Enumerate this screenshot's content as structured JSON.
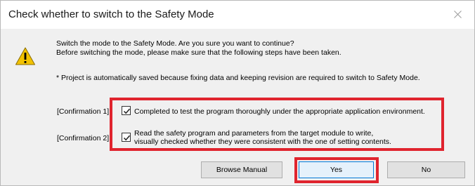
{
  "window": {
    "title": "Check whether to switch to the Safety Mode"
  },
  "message": {
    "line1": "Switch the mode to the Safety Mode. Are you sure you want to continue?",
    "line2": "Before switching the mode, please make sure that the following steps have been taken.",
    "note": "* Project is automatically saved because fixing data and keeping revision are required to switch to Safety Mode."
  },
  "confirmations": [
    {
      "label": "[Confirmation 1]",
      "checked": true,
      "text_lines": [
        "Completed to test the program thoroughly under the appropriate application environment."
      ]
    },
    {
      "label": "[Confirmation 2]",
      "checked": true,
      "text_lines": [
        "Read the safety program and parameters from the target module to write,",
        "visually checked whether they were consistent with the one of setting contents."
      ]
    }
  ],
  "buttons": {
    "browse_manual": "Browse Manual",
    "yes": "Yes",
    "no": "No"
  },
  "colors": {
    "highlight": "#e0242e",
    "warning": "#f2c200"
  },
  "icons": {
    "warning": "warning-icon",
    "close": "close-icon",
    "check": "checkmark-icon"
  }
}
